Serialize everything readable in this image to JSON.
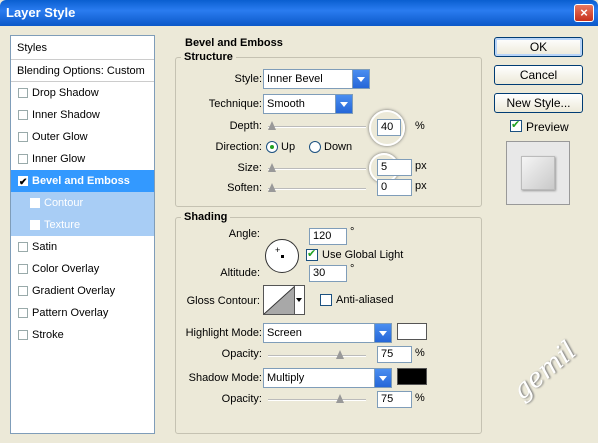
{
  "window": {
    "title": "Layer Style",
    "close_glyph": "×"
  },
  "style_list": {
    "header": "Styles",
    "blending": "Blending Options: Custom",
    "items": [
      {
        "label": "Drop Shadow",
        "checked": false
      },
      {
        "label": "Inner Shadow",
        "checked": false
      },
      {
        "label": "Outer Glow",
        "checked": false
      },
      {
        "label": "Inner Glow",
        "checked": false
      },
      {
        "label": "Bevel and Emboss",
        "checked": true,
        "selected": true
      },
      {
        "label": "Contour",
        "checked": false,
        "sub": true
      },
      {
        "label": "Texture",
        "checked": false,
        "sub": true
      },
      {
        "label": "Satin",
        "checked": false
      },
      {
        "label": "Color Overlay",
        "checked": false
      },
      {
        "label": "Gradient Overlay",
        "checked": false
      },
      {
        "label": "Pattern Overlay",
        "checked": false
      },
      {
        "label": "Stroke",
        "checked": false
      }
    ]
  },
  "bevel": {
    "heading": "Bevel and Emboss",
    "structure": {
      "legend": "Structure",
      "style_label": "Style:",
      "style_value": "Inner Bevel",
      "technique_label": "Technique:",
      "technique_value": "Smooth",
      "depth_label": "Depth:",
      "depth_value": "40",
      "depth_unit": "%",
      "depth_slider": 0.0,
      "direction_label": "Direction:",
      "dir_up": "Up",
      "dir_down": "Down",
      "direction_selected": "Up",
      "size_label": "Size:",
      "size_value": "5",
      "size_unit": "px",
      "size_slider": 0.0,
      "soften_label": "Soften:",
      "soften_value": "0",
      "soften_unit": "px",
      "soften_slider": 0.0
    },
    "shading": {
      "legend": "Shading",
      "angle_label": "Angle:",
      "angle_value": "120",
      "angle_unit": "°",
      "global_light_label": "Use Global Light",
      "global_light": true,
      "altitude_label": "Altitude:",
      "altitude_value": "30",
      "altitude_unit": "°",
      "gloss_label": "Gloss Contour:",
      "anti_aliased_label": "Anti-aliased",
      "anti_aliased": false,
      "highlight_mode_label": "Highlight Mode:",
      "highlight_mode_value": "Screen",
      "highlight_color": "#ffffff",
      "highlight_opacity_label": "Opacity:",
      "highlight_opacity_value": "75",
      "highlight_opacity_unit": "%",
      "highlight_opacity_slider": 0.75,
      "shadow_mode_label": "Shadow Mode:",
      "shadow_mode_value": "Multiply",
      "shadow_color": "#000000",
      "shadow_opacity_label": "Opacity:",
      "shadow_opacity_value": "75",
      "shadow_opacity_unit": "%",
      "shadow_opacity_slider": 0.75
    }
  },
  "buttons": {
    "ok": "OK",
    "cancel": "Cancel",
    "new_style": "New Style...",
    "preview_label": "Preview",
    "preview": true
  },
  "watermark": "gemil"
}
